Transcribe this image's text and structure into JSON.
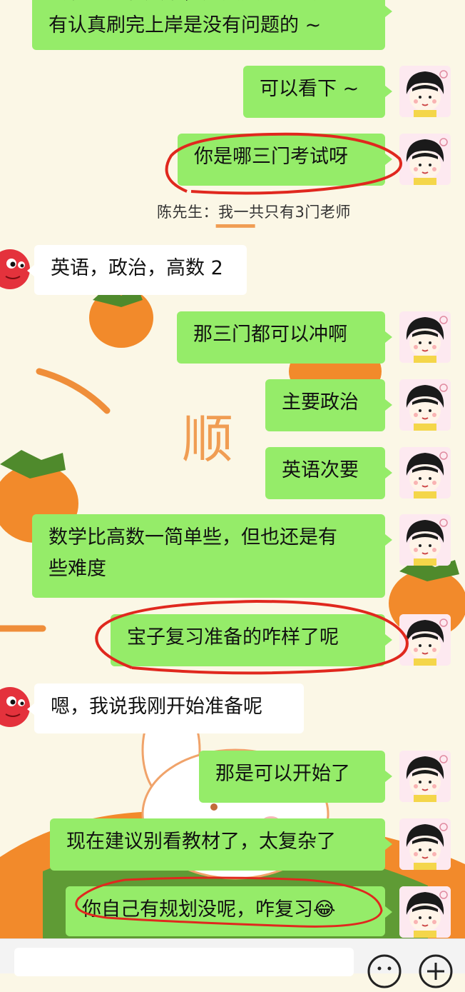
{
  "messages": [
    {
      "side": "me",
      "text": "会有好题和英语，还真大概也会有认真刷完上岸是没有问题的 ~",
      "partial_top": true
    },
    {
      "side": "me",
      "text": "可以看下 ~"
    },
    {
      "side": "me",
      "text": "你是哪三门考试呀",
      "highlighted": true
    },
    {
      "side": "me",
      "text": "那三门都可以冲啊"
    },
    {
      "side": "me",
      "text": "主要政治"
    },
    {
      "side": "me",
      "text": "英语次要"
    },
    {
      "side": "me",
      "text": "数学比高数一简单些，但也还是有些难度"
    },
    {
      "side": "me",
      "text": "宝子复习准备的咋样了呢",
      "highlighted": true
    },
    {
      "side": "me",
      "text": "那是可以开始了"
    },
    {
      "side": "me",
      "text": "现在建议别看教材了，太复杂了"
    },
    {
      "side": "me",
      "text": "你自己有规划没呢，咋复习😂",
      "highlighted": true
    }
  ],
  "first_lines": [
    "会有好题和英语，还真大概也会",
    "有认真刷完上岸是没有问题的 ~"
  ],
  "math_lines": [
    "数学比高数一简单些，但也还是有",
    "些难度"
  ],
  "quote": {
    "text": "陈先生：我一共只有3门老师"
  },
  "replies": [
    {
      "side": "them",
      "text": "英语，政治，高数 2"
    },
    {
      "side": "them",
      "text": "嗯，我说我刚开始准备呢"
    }
  ],
  "background_text": [
    "一",
    "顺"
  ],
  "icons": {
    "my_avatar": "girl-avatar-icon",
    "their_avatar": "tomato-avatar-icon",
    "emoji_button": "smiley-icon",
    "more_button": "plus-icon"
  },
  "colors": {
    "my_bubble": "#95ec69",
    "their_bubble": "#ffffff",
    "annotation": "#e0281e",
    "background": "#fbf7e6"
  }
}
